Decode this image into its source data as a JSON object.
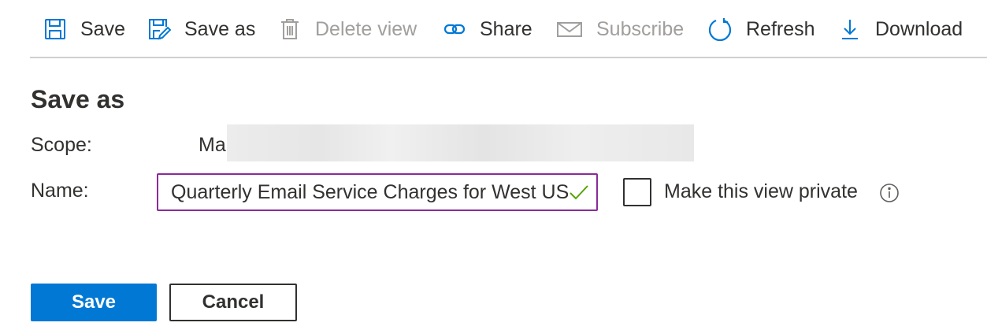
{
  "toolbar": {
    "items": [
      {
        "label": "Save",
        "icon": "save-icon",
        "enabled": true
      },
      {
        "label": "Save as",
        "icon": "save-as-icon",
        "enabled": true
      },
      {
        "label": "Delete view",
        "icon": "trash-icon",
        "enabled": false
      },
      {
        "label": "Share",
        "icon": "link-icon",
        "enabled": true
      },
      {
        "label": "Subscribe",
        "icon": "mail-icon",
        "enabled": false
      },
      {
        "label": "Refresh",
        "icon": "refresh-icon",
        "enabled": true
      },
      {
        "label": "Download",
        "icon": "download-icon",
        "enabled": true
      }
    ]
  },
  "form": {
    "title": "Save as",
    "scope_label": "Scope:",
    "scope_value": "Ma",
    "name_label": "Name:",
    "name_value": "Quarterly Email Service Charges for West US",
    "private_label": "Make this view private",
    "private_checked": false
  },
  "buttons": {
    "save": "Save",
    "cancel": "Cancel"
  },
  "colors": {
    "accent": "#0078d4",
    "input_border": "#8a2b99",
    "valid_check": "#57a300",
    "disabled_text": "#a19f9d"
  }
}
